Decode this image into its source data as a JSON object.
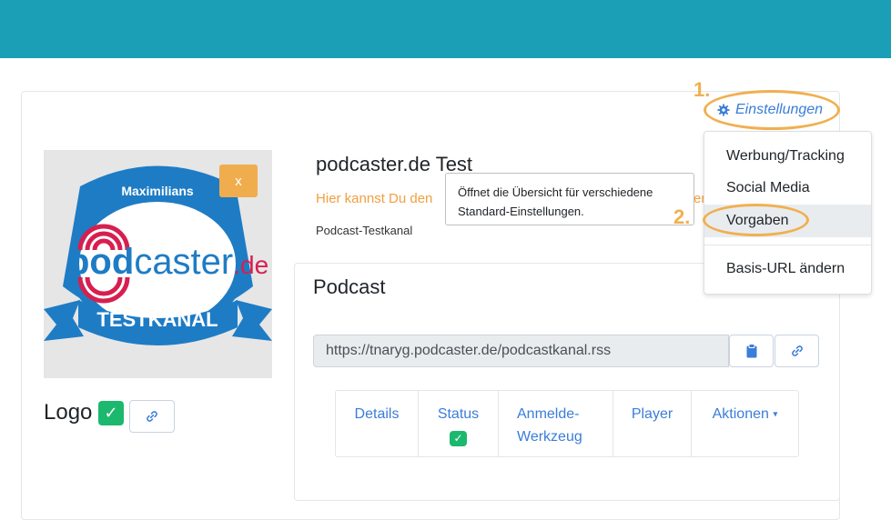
{
  "colors": {
    "header": "#1a9fb7",
    "accent_blue": "#3b7dd8",
    "annotation_orange": "#f0b050",
    "success_green": "#1cb86e",
    "warning_orange": "#f0ad4e"
  },
  "logo": {
    "banner_top": "Maximilians",
    "brand_pod": "pod",
    "brand_caster": "caster",
    "brand_tld": ".de",
    "banner_bottom": "TESTKANAL",
    "remove_label": "x",
    "label": "Logo",
    "status_check": "✓"
  },
  "channel": {
    "title": "podcaster.de Test",
    "hint": "Hier kannst Du den",
    "hint_tail": "er",
    "subtitle": "Podcast-Testkanal"
  },
  "tooltip": {
    "line1": "Öffnet die Übersicht für verschiedene",
    "line2": "Standard-Einstellungen."
  },
  "podcast": {
    "title": "Podcast",
    "rss_url": "https://tnaryg.podcaster.de/podcastkanal.rss",
    "copy_icon": "clipboard-icon",
    "link_icon": "link-icon"
  },
  "tabs": {
    "details": "Details",
    "status": "Status",
    "status_check": "✓",
    "anmelde_line1": "Anmelde-",
    "anmelde_line2": "Werkzeug",
    "player": "Player",
    "aktionen": "Aktionen"
  },
  "settings": {
    "label": "Einstellungen",
    "icon": "gear-icon",
    "step1": "1.",
    "step2": "2."
  },
  "menu": {
    "items": [
      "Werbung/Tracking",
      "Social Media",
      "Vorgaben",
      "Basis-URL ändern"
    ],
    "active": "Vorgaben"
  }
}
